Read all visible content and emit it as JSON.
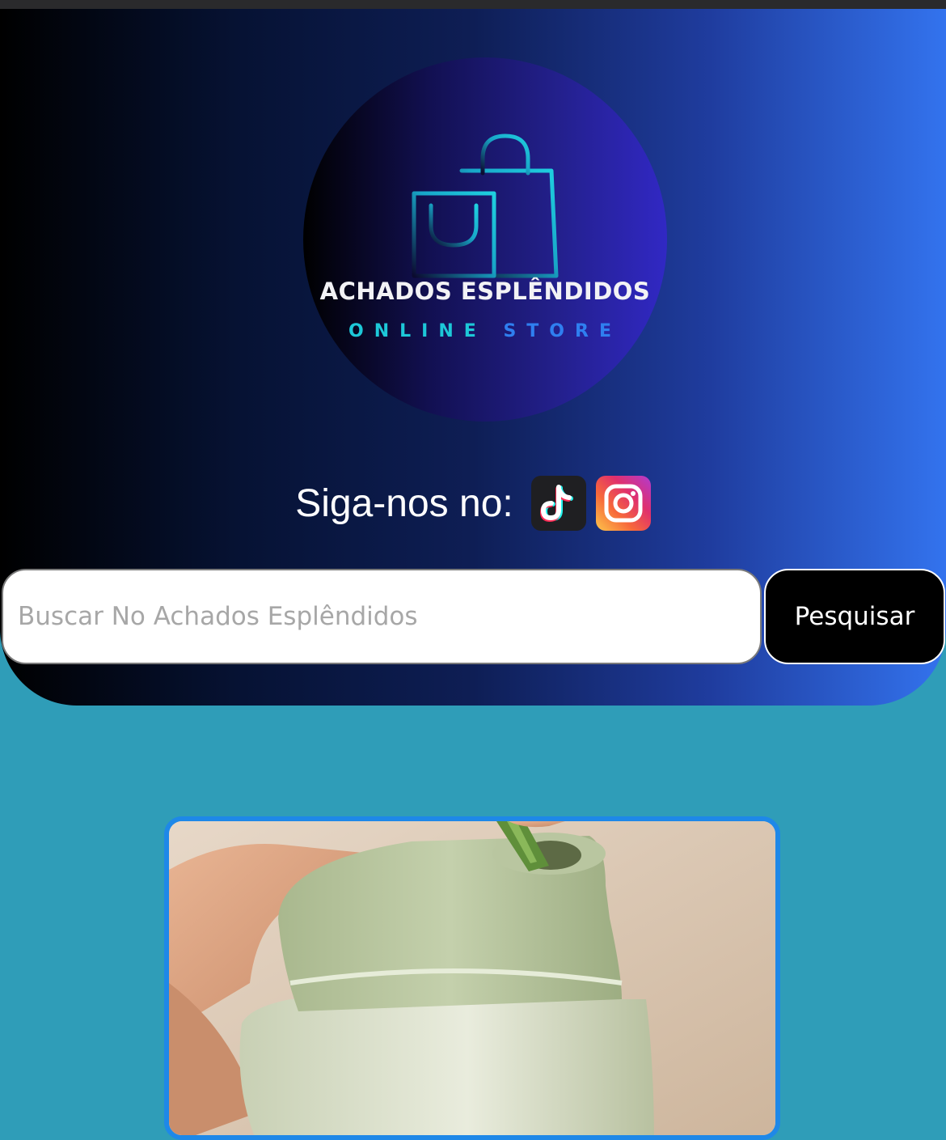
{
  "header": {
    "brand_name": "ACHADOS ESPLÊNDIDOS",
    "brand_sub_word1": "ONLINE",
    "brand_sub_word2": "STORE",
    "follow_text": "Siga-nos no:",
    "social": [
      {
        "name": "TikTok",
        "icon": "tiktok-icon"
      },
      {
        "name": "Instagram",
        "icon": "instagram-icon"
      }
    ]
  },
  "search": {
    "placeholder": "Buscar No Achados Esplêndidos",
    "value": "",
    "button_label": "Pesquisar"
  },
  "colors": {
    "page_background": "#2f9db8",
    "header_gradient_start": "#000000",
    "header_gradient_end": "#3373ee",
    "logo_accent": "#1dc8d8",
    "card_border": "#1e88e8",
    "button_background": "#000000"
  },
  "products": [
    {
      "image": "vegetable-cutter-product-image"
    }
  ]
}
